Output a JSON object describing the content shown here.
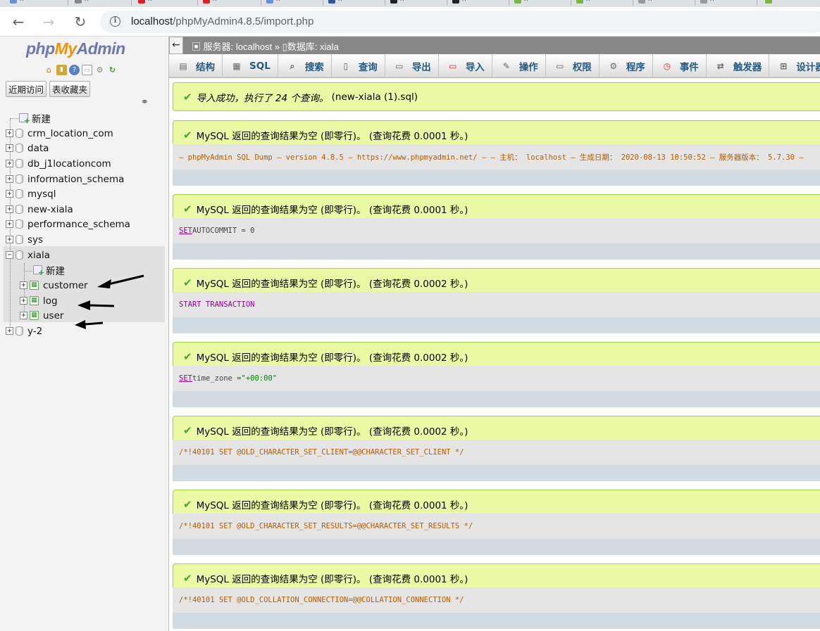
{
  "browser": {
    "url_host": "localhost",
    "url_path": "/phpMyAdmin4.8.5/import.php"
  },
  "sidebar": {
    "logo": {
      "php": "php",
      "my": "My",
      "admin": "Admin"
    },
    "quick_tabs": [
      "近期访问",
      "表收藏夹"
    ],
    "new_label": "新建",
    "databases": [
      "crm_location_com",
      "data",
      "db_j1locationcom",
      "information_schema",
      "mysql",
      "new-xiala",
      "performance_schema",
      "sys",
      "xiala",
      "y-2"
    ],
    "xiala_children": {
      "new_label": "新建",
      "tables": [
        "customer",
        "log",
        "user"
      ]
    }
  },
  "breadcrumb": {
    "server": "服务器: localhost »",
    "database": "数据库: xiala"
  },
  "menu": [
    {
      "label": "结构",
      "icon": "structure-icon"
    },
    {
      "label": "SQL",
      "icon": "sql-icon"
    },
    {
      "label": "搜索",
      "icon": "search-icon"
    },
    {
      "label": "查询",
      "icon": "query-icon"
    },
    {
      "label": "导出",
      "icon": "export-icon"
    },
    {
      "label": "导入",
      "icon": "import-icon"
    },
    {
      "label": "操作",
      "icon": "wrench-icon"
    },
    {
      "label": "权限",
      "icon": "privileges-icon"
    },
    {
      "label": "程序",
      "icon": "routines-icon"
    },
    {
      "label": "事件",
      "icon": "events-icon"
    },
    {
      "label": "触发器",
      "icon": "triggers-icon"
    },
    {
      "label": "设计器",
      "icon": "designer-icon"
    }
  ],
  "import_result": {
    "message": "导入成功，执行了 24 个查询。",
    "filename": "(new-xiala (1).sql)"
  },
  "results": [
    {
      "message": "MySQL 返回的查询结果为空 (即零行)。 (查询花费 0.0001 秒。)",
      "sql": "— phpMyAdmin SQL Dump — version 4.8.5 — https://www.phpmyadmin.net/ — — 主机： localhost — 生成日期： 2020-08-13 10:50:52 — 服务器版本： 5.7.30 —"
    },
    {
      "message": "MySQL 返回的查询结果为空 (即零行)。 (查询花费 0.0001 秒。)",
      "sql_kw": "SET",
      "sql_rest": " AUTOCOMMIT = 0"
    },
    {
      "message": "MySQL 返回的查询结果为空 (即零行)。 (查询花费 0.0002 秒。)",
      "sql_kw": "START TRANSACTION",
      "sql_rest": ""
    },
    {
      "message": "MySQL 返回的查询结果为空 (即零行)。 (查询花费 0.0002 秒。)",
      "sql_kw": "SET",
      "sql_rest": " time_zone = ",
      "sql_str": "\"+00:00\""
    },
    {
      "message": "MySQL 返回的查询结果为空 (即零行)。 (查询花费 0.0002 秒。)",
      "sql": "/*!40101 SET @OLD_CHARACTER_SET_CLIENT=@@CHARACTER_SET_CLIENT */"
    },
    {
      "message": "MySQL 返回的查询结果为空 (即零行)。 (查询花费 0.0001 秒。)",
      "sql": "/*!40101 SET @OLD_CHARACTER_SET_RESULTS=@@CHARACTER_SET_RESULTS */"
    },
    {
      "message": "MySQL 返回的查询结果为空 (即零行)。 (查询花费 0.0001 秒。)",
      "sql": "/*!40101 SET @OLD_COLLATION_CONNECTION=@@COLLATION_CONNECTION */"
    }
  ]
}
